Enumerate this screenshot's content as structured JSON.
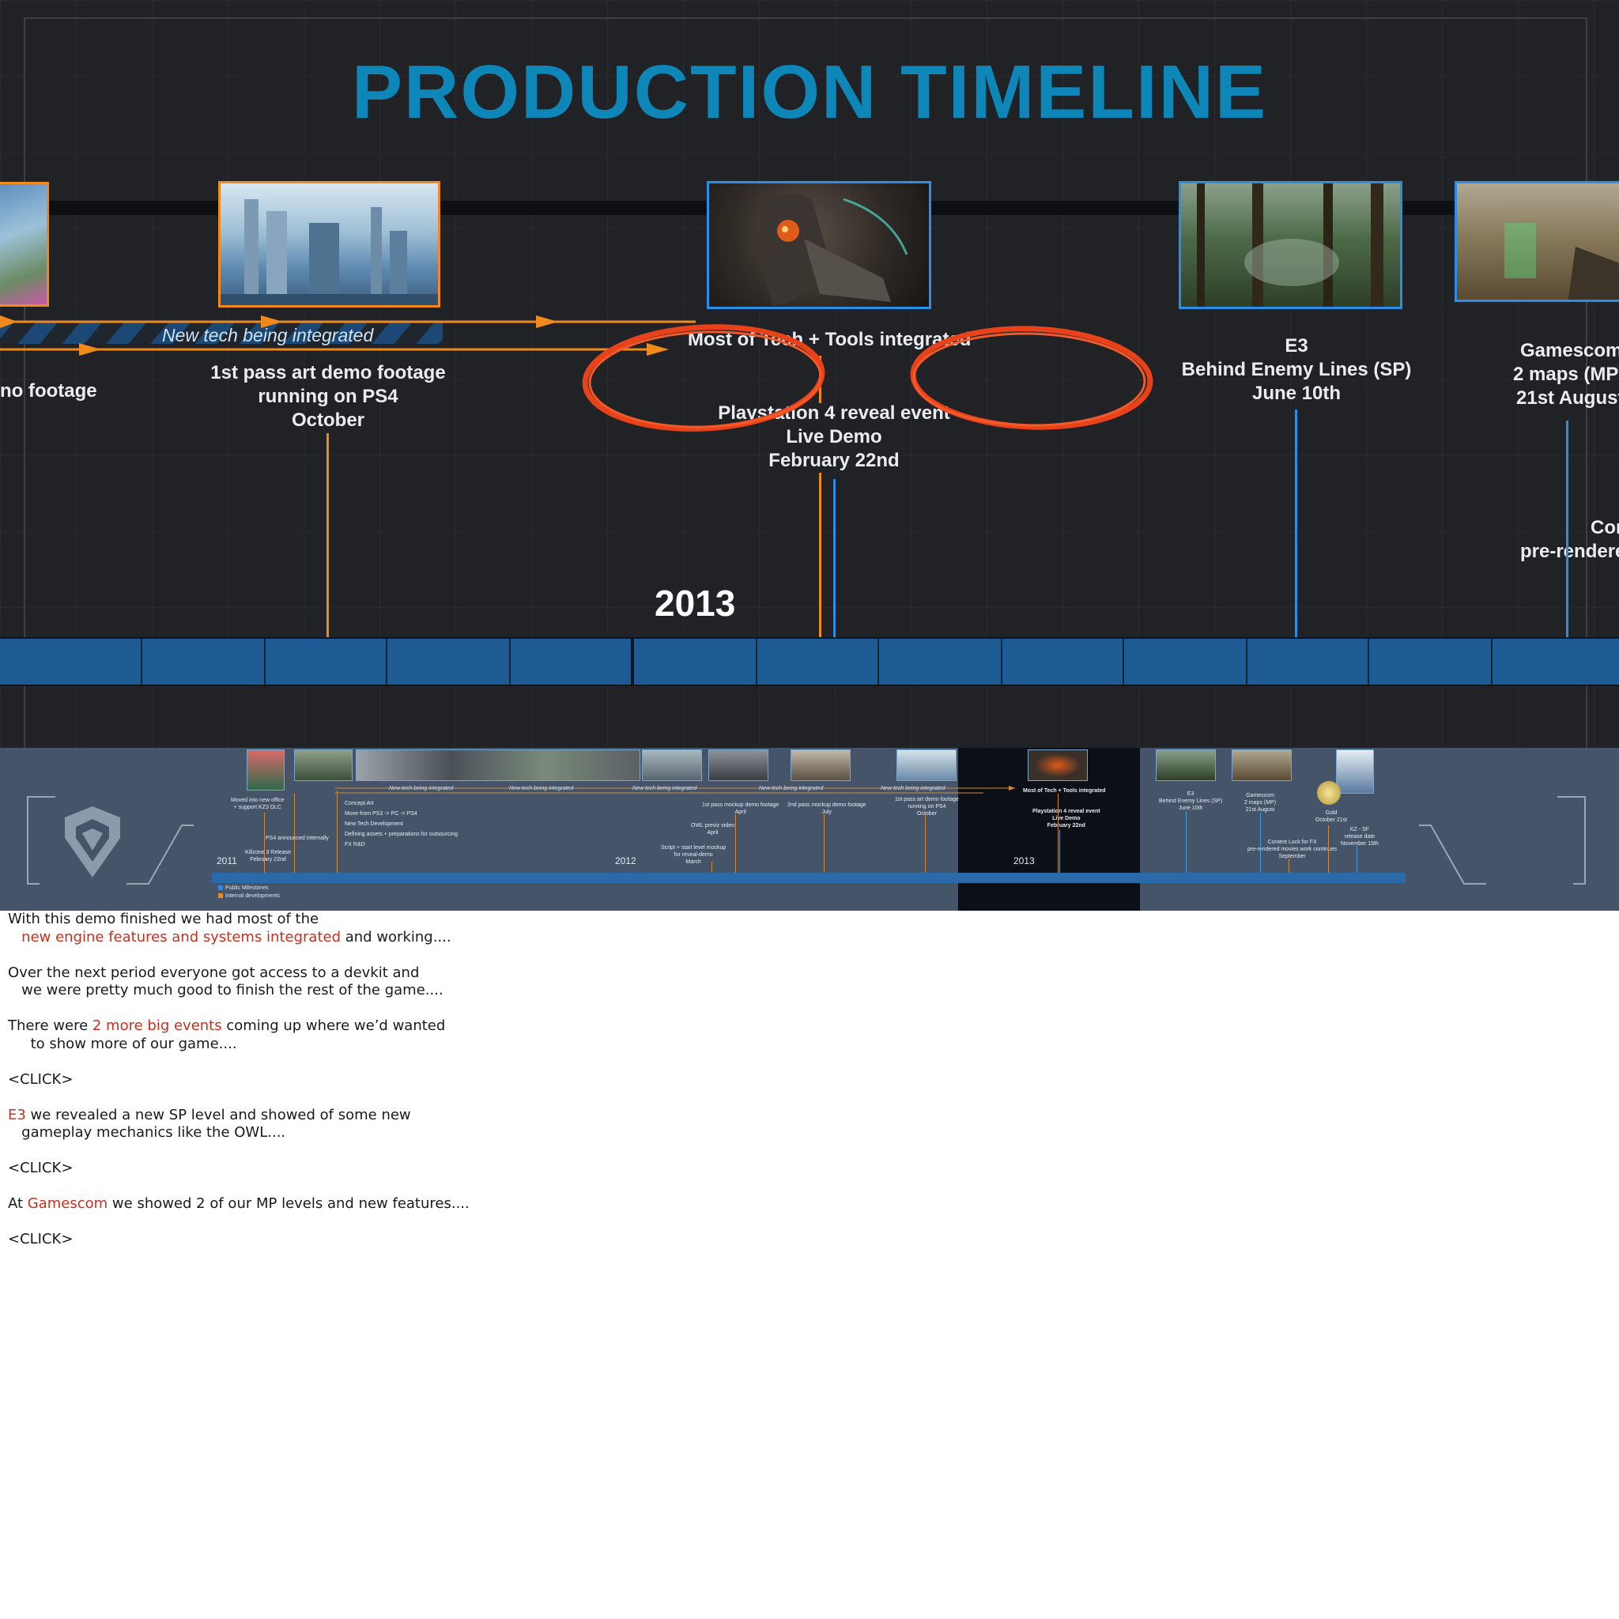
{
  "slide": {
    "title": "PRODUCTION TIMELINE",
    "year": "2013",
    "tech_banner": "New tech being integrated",
    "labels": {
      "demo_footage_left": "no footage",
      "art_demo": [
        "1st pass art demo footage",
        "running on PS4",
        "October"
      ],
      "most_tech": "Most of Tech + Tools integrated",
      "ps4_reveal": [
        "Playstation 4 reveal event",
        "Live Demo",
        "February 22nd"
      ],
      "e3": [
        "E3",
        "Behind Enemy Lines (SP)",
        "June 10th"
      ],
      "gamescom": [
        "Gamescom",
        "2 maps (MP)",
        "21st August"
      ],
      "cut_right": [
        "Cor",
        "pre-rendere"
      ]
    },
    "colors": {
      "accent_orange": "#f08a1c",
      "accent_blue": "#2a8ee6",
      "title_blue": "#0e86b8",
      "circle_red": "#e8421a"
    }
  },
  "overview": {
    "years": [
      "2011",
      "2012",
      "2013"
    ],
    "legend": [
      "Public Milestones",
      "Internal developments"
    ],
    "notes_small": {
      "moved": [
        "Moved into new office",
        "+ support KZ3 DLC"
      ],
      "kz3": [
        "Killzone 3 Release",
        "February 22nd"
      ],
      "ps4_announced": "PS4 announced internally",
      "tasks": [
        "Concept Art",
        "Move from PS3 -> PC -> PS4",
        "New Tech Development",
        "Defining assets + preparations for outsourcing",
        "FX R&D"
      ],
      "mockup1": [
        "1st pass mockup demo footage",
        "April"
      ],
      "owl": [
        "OWL previz video",
        "April"
      ],
      "script": [
        "Script + start level mockup",
        "for reveal-demo",
        "March"
      ],
      "mockup2": [
        "2nd pass mockup demo footage",
        "July"
      ],
      "art_demo": [
        "1st pass art demo footage",
        "running on PS4",
        "October"
      ],
      "most_tech": "Most of Tech + Tools integrated",
      "ps4_reveal": [
        "Playstation 4 reveal event",
        "Live Demo",
        "February 22nd"
      ],
      "e3": [
        "E3",
        "Behind Enemy Lines (SP)",
        "June 10th"
      ],
      "gamescom": [
        "Gamescom",
        "2 maps (MP)",
        "21st August"
      ],
      "content_lock": [
        "Content Lock for FX",
        "pre-rendered movies work continues",
        "September"
      ],
      "gold": [
        "Gold",
        "October 21st"
      ],
      "release": [
        "KZ - SF",
        "release date",
        "November 15th"
      ],
      "tech_small": "New tech being integrated"
    }
  },
  "notes": {
    "p1_line1": "With this demo finished we had most of the",
    "p1_line2_hl": "new engine features and systems integrated",
    "p1_line2_rest": " and working....",
    "p2_line1": "Over the next period everyone got access to a devkit and",
    "p2_line2": "   we were pretty much good to finish the rest of the game....",
    "p3_line1_pre": "There were ",
    "p3_line1_hl": "2 more big events",
    "p3_line1_post": " coming up where we’d wanted",
    "p3_line2": "     to show more of our game....",
    "click": "<CLICK>",
    "p4_line1_hl": "E3",
    "p4_line1_rest": " we revealed a new SP level and showed of some new",
    "p4_line2": "   gameplay mechanics like the OWL....",
    "p5_pre": "At ",
    "p5_hl": "Gamescom",
    "p5_rest": " we showed 2 of our MP levels and new features...."
  }
}
